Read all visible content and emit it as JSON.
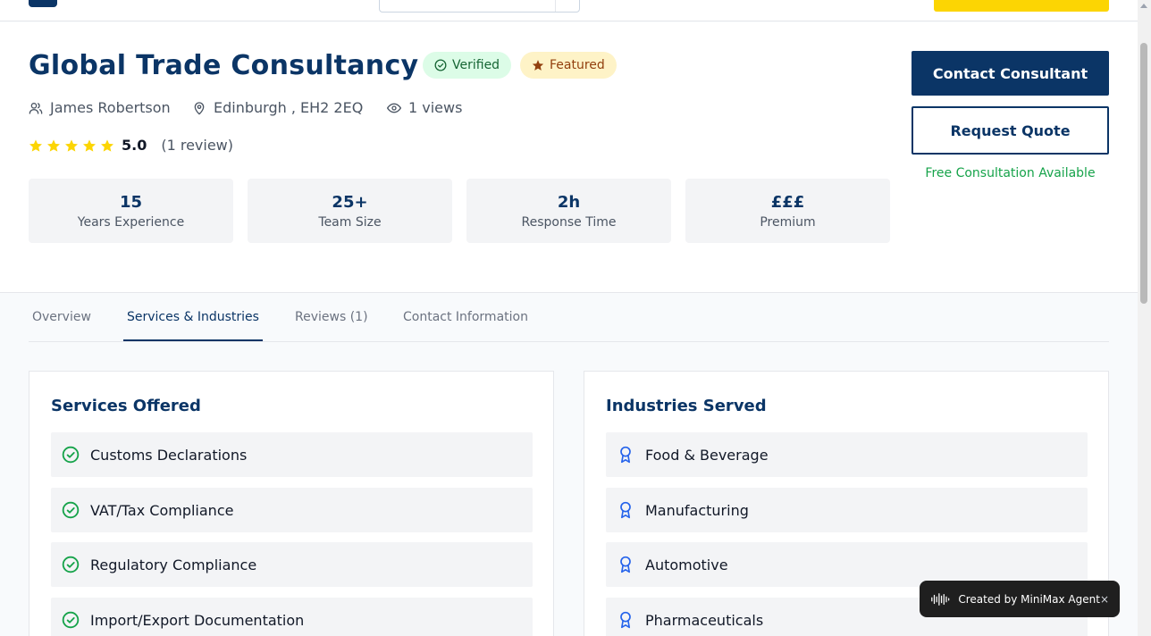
{
  "header": {
    "logo_color": "#0b3566",
    "accent_color": "#fcd503"
  },
  "profile": {
    "title": "Global Trade Consultancy",
    "badges": {
      "verified": "Verified",
      "featured": "Featured"
    },
    "contact_name": "James Robertson",
    "location": "Edinburgh  , EH2 2EQ",
    "views": "1 views",
    "rating": {
      "stars": 5,
      "value": "5.0",
      "count_text": "(1 review)"
    },
    "stats": [
      {
        "value": "15",
        "label": "Years Experience"
      },
      {
        "value": "25+",
        "label": "Team Size"
      },
      {
        "value": "2h",
        "label": "Response Time"
      },
      {
        "value": "£££",
        "label": "Premium"
      }
    ],
    "actions": {
      "contact_label": "Contact Consultant",
      "quote_label": "Request Quote",
      "free_consultation": "Free Consultation Available"
    }
  },
  "tabs": [
    {
      "label": "Overview",
      "active": false
    },
    {
      "label": "Services & Industries",
      "active": true
    },
    {
      "label": "Reviews (1)",
      "active": false
    },
    {
      "label": "Contact Information",
      "active": false
    }
  ],
  "services": {
    "heading": "Services Offered",
    "items": [
      "Customs Declarations",
      "VAT/Tax Compliance",
      "Regulatory Compliance",
      "Import/Export Documentation"
    ]
  },
  "industries": {
    "heading": "Industries Served",
    "items": [
      "Food & Beverage",
      "Manufacturing",
      "Automotive",
      "Pharmaceuticals"
    ]
  },
  "toast": {
    "text": "Created by MiniMax Agent",
    "close": "×"
  },
  "colors": {
    "primary": "#0b3566",
    "success": "#16a34a",
    "star": "#fcd503",
    "industry_icon": "#2563eb"
  },
  "icons": {
    "verified": "check-circle-icon",
    "featured": "star-icon",
    "person": "user-icon",
    "location": "map-pin-icon",
    "views": "eye-icon",
    "service": "check-circle-icon",
    "industry": "award-icon",
    "toast": "soundwave-icon"
  }
}
